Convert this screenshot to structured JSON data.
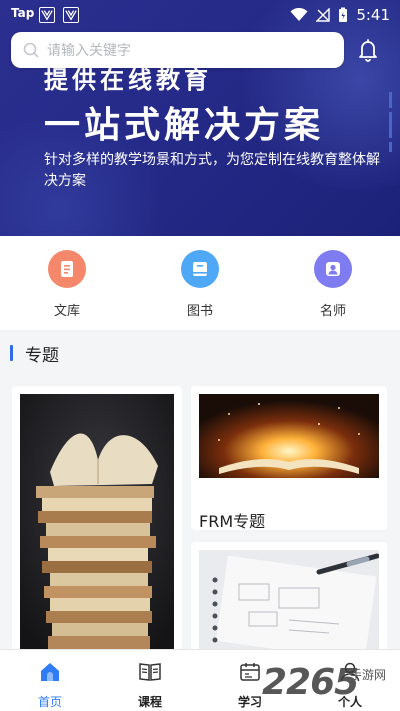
{
  "status_bar": {
    "carrier": "Tap",
    "time": "5:41"
  },
  "search": {
    "placeholder": "请输入关键字"
  },
  "banner": {
    "title_top": "提供在线教育",
    "title_main": "一站式解决方案",
    "description": "针对多样的教学场景和方式，为您定制在线教育整体解决方案"
  },
  "categories": [
    {
      "label": "文库",
      "icon": "document-icon",
      "color": "#f5876a"
    },
    {
      "label": "图书",
      "icon": "book-icon",
      "color": "#4fa8f5"
    },
    {
      "label": "名师",
      "icon": "person-icon",
      "color": "#7f7cf2"
    }
  ],
  "section": {
    "title": "专题"
  },
  "cards": [
    {
      "caption": ""
    },
    {
      "caption": "FRM专题"
    },
    {
      "caption": ""
    }
  ],
  "nav": {
    "items": [
      {
        "label": "首页",
        "icon": "home-icon",
        "active": true
      },
      {
        "label": "课程",
        "icon": "open-book-icon"
      },
      {
        "label": "学习",
        "icon": "calendar-icon"
      },
      {
        "label": "个人",
        "icon": "profile-icon"
      }
    ]
  },
  "watermark": {
    "text": "2265",
    "sub": "手游网"
  },
  "colors": {
    "accent": "#2f7cf6",
    "banner": "#252a88"
  }
}
